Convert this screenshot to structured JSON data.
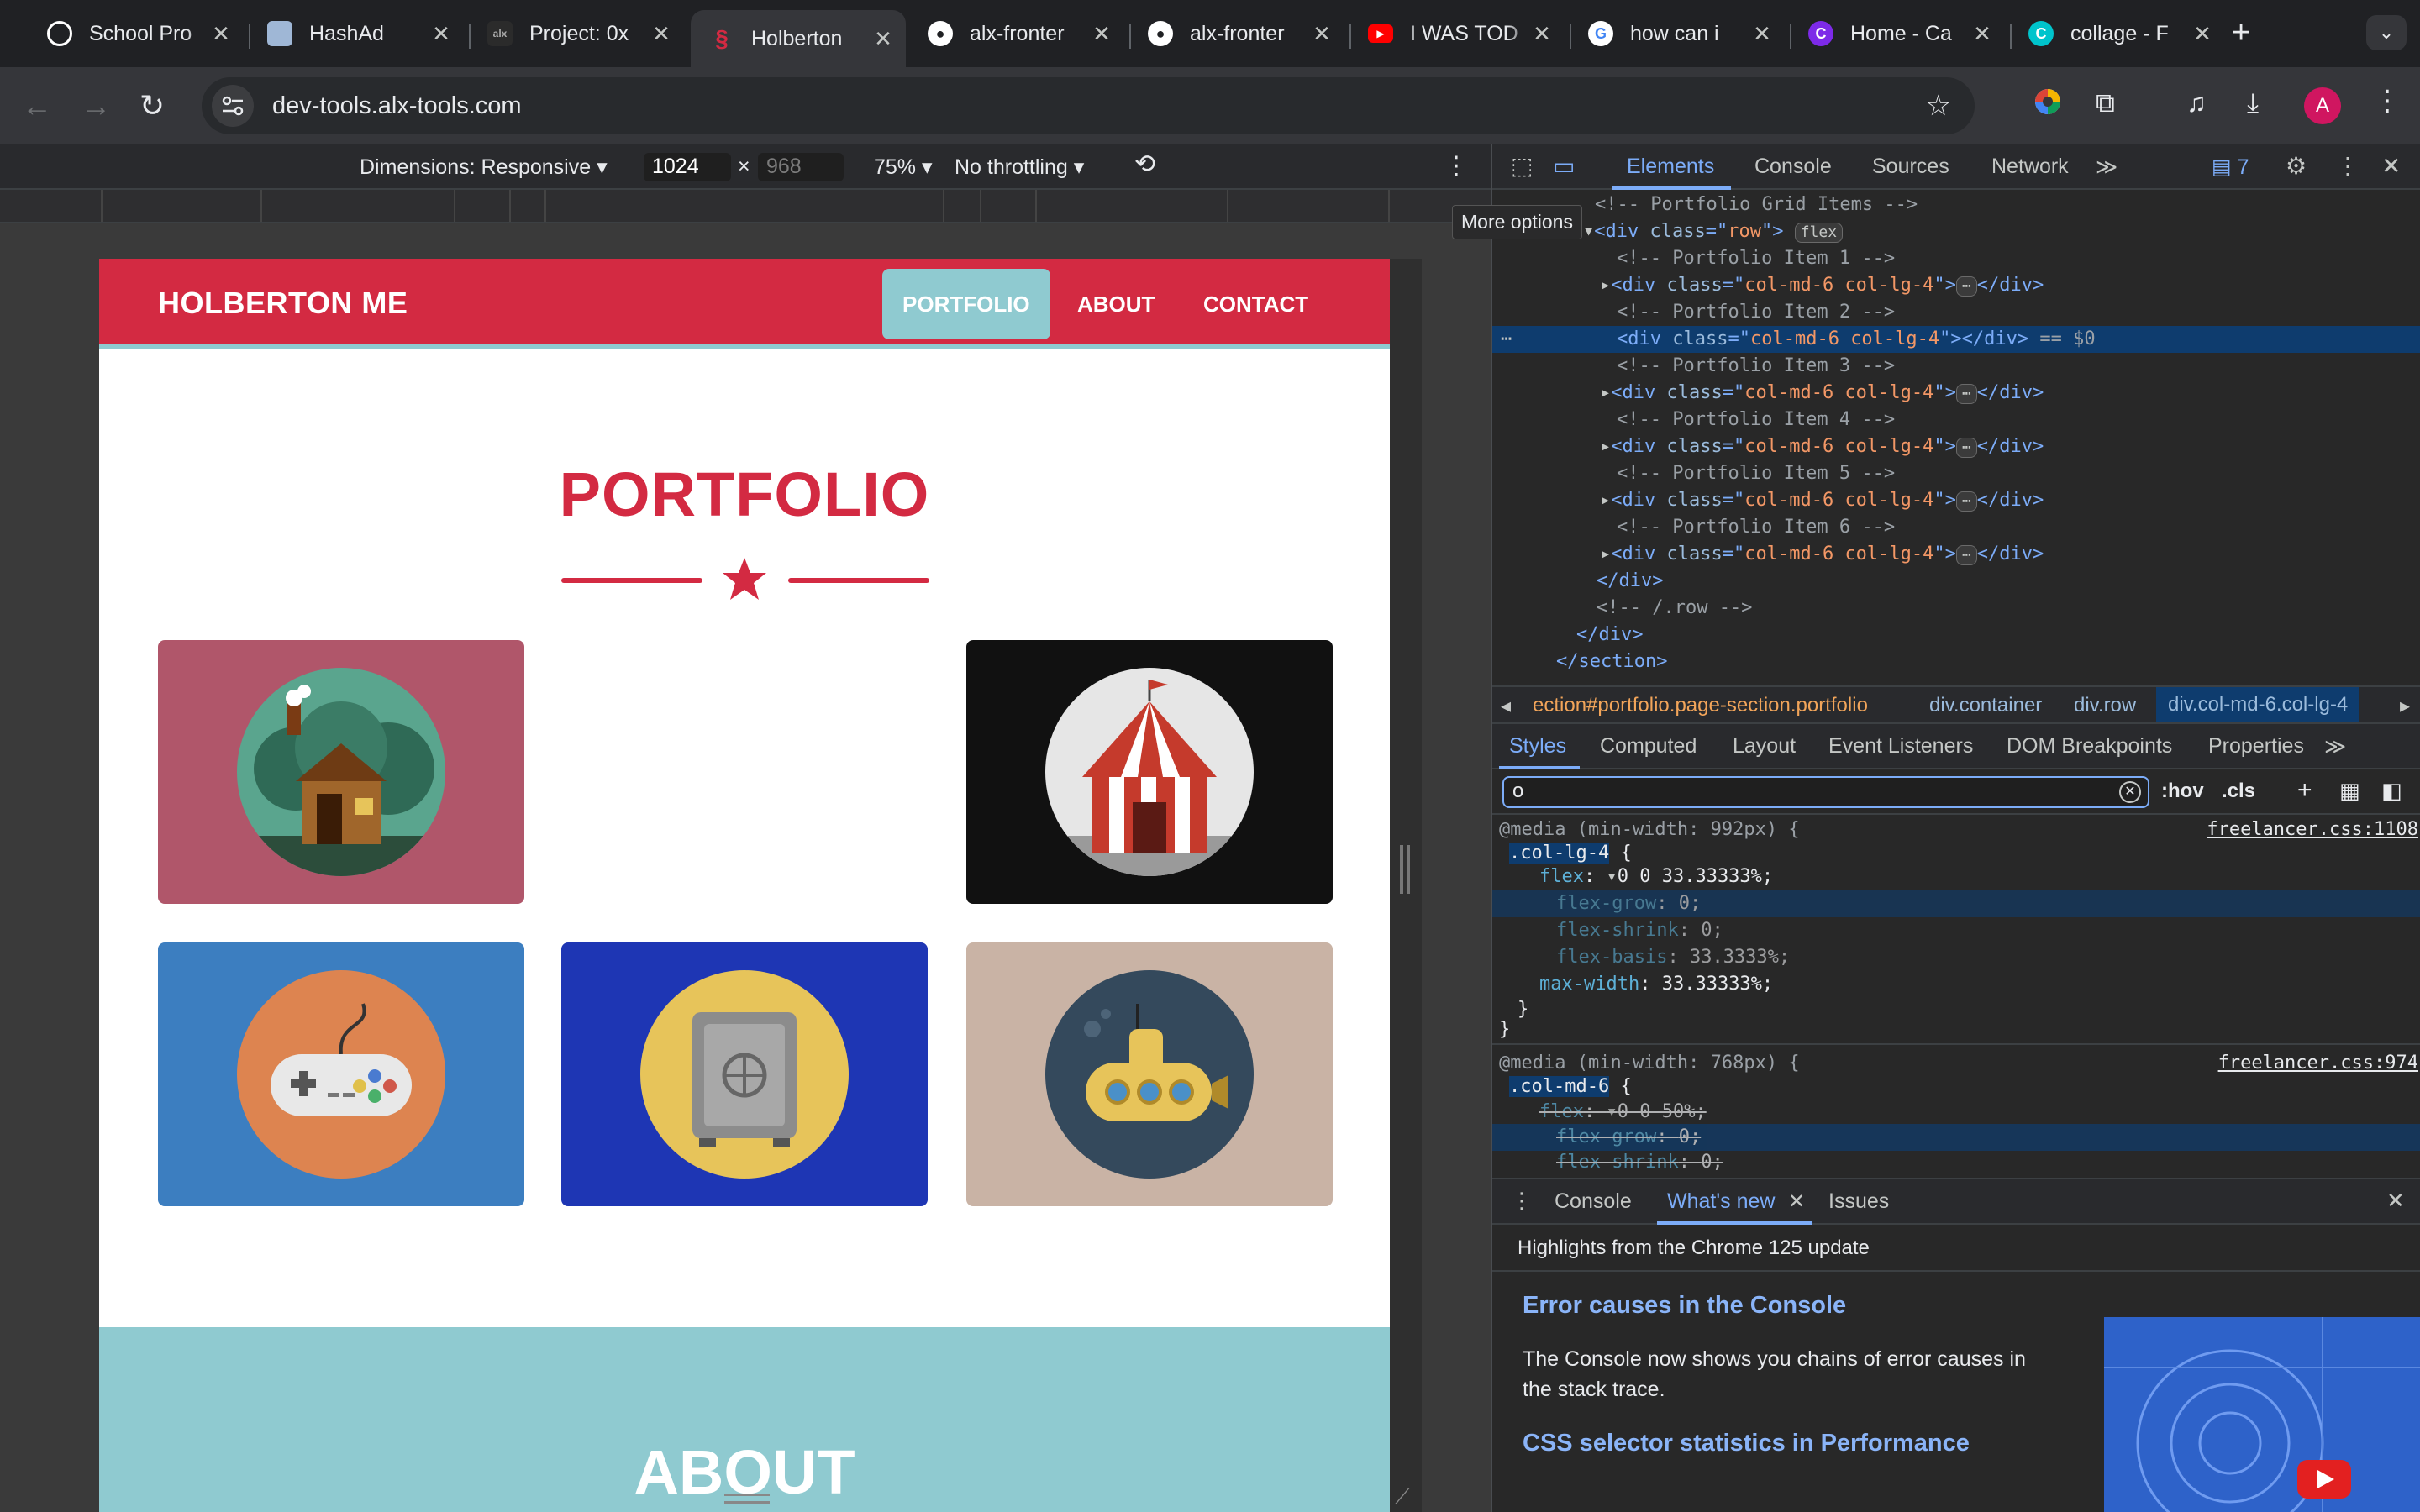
{
  "browser": {
    "tabs": [
      {
        "title": "School Pro",
        "icon": "openai-icon",
        "color": "#ffffff"
      },
      {
        "title": "HashAd",
        "icon": "hashad-icon",
        "color": "#9fb7d6"
      },
      {
        "title": "Project: 0x",
        "icon": "alx-icon",
        "color": "#202124"
      },
      {
        "title": "Holberton",
        "icon": "holberton-icon",
        "color": "#d32a42"
      },
      {
        "title": "alx-fronter",
        "icon": "github-icon",
        "color": "#ffffff"
      },
      {
        "title": "alx-fronter",
        "icon": "github-icon",
        "color": "#ffffff"
      },
      {
        "title": "I WAS TOD",
        "icon": "youtube-icon",
        "color": "#ff0000"
      },
      {
        "title": "how can i",
        "icon": "google-icon",
        "color": "#ffffff"
      },
      {
        "title": "Home - Ca",
        "icon": "canva-icon",
        "color": "#7d2ae8"
      },
      {
        "title": "collage - F",
        "icon": "canva-icon",
        "color": "#00c4cc"
      }
    ],
    "url": "dev-tools.alx-tools.com",
    "profile_initial": "A"
  },
  "device_toolbar": {
    "dimensions_label": "Dimensions: Responsive",
    "width": "1024",
    "times": "×",
    "height": "968",
    "zoom": "75%",
    "throttling": "No throttling"
  },
  "tooltip": "More options",
  "site": {
    "brand": "HOLBERTON ME",
    "nav": [
      "PORTFOLIO",
      "ABOUT",
      "CONTACT"
    ],
    "title": "PORTFOLIO",
    "about_title": "ABOUT",
    "colors": {
      "primary": "#d32a42",
      "accent": "#8fcad0"
    },
    "cards": [
      {
        "name": "cabin",
        "bg": "#b0566a",
        "circle": "#5aa58e"
      },
      {
        "name": "circus",
        "bg": "#111111",
        "circle": "#e6e6e6"
      },
      {
        "name": "game",
        "bg": "#3c7ec0",
        "circle": "#dd8450"
      },
      {
        "name": "safe",
        "bg": "#1e36b4",
        "circle": "#e7c45a"
      },
      {
        "name": "submarine",
        "bg": "#c9b3a5",
        "circle": "#34495c"
      }
    ]
  },
  "devtools": {
    "tabs": [
      "Elements",
      "Console",
      "Sources",
      "Network"
    ],
    "issues_count": "7",
    "dom": {
      "comment_grid": "<!-- Portfolio Grid Items -->",
      "row_open_tag": "div",
      "row_class": "row",
      "flex_badge": "flex",
      "item_tag": "div",
      "item_class": "col-md-6 col-lg-4",
      "item_comments": [
        "<!-- Portfolio Item 1 -->",
        "<!-- Portfolio Item 2 -->",
        "<!-- Portfolio Item 3 -->",
        "<!-- Portfolio Item 4 -->",
        "<!-- Portfolio Item 5 -->",
        "<!-- Portfolio Item 6 -->"
      ],
      "selected_suffix": "== $0",
      "close_div": "</div>",
      "row_end_comment": "<!-- /.row -->",
      "close_section": "</section>"
    },
    "breadcrumbs": [
      "ection#portfolio.page-section.portfolio",
      "div.container",
      "div.row",
      "div.col-md-6.col-lg-4"
    ],
    "style_tabs": [
      "Styles",
      "Computed",
      "Layout",
      "Event Listeners",
      "DOM Breakpoints",
      "Properties"
    ],
    "filter_value": "o",
    "hov": ":hov",
    "cls": ".cls",
    "rules": [
      {
        "media": "@media (min-width: 992px) {",
        "source": "freelancer.css:1108",
        "selector": ".col-lg-4",
        "decls": [
          {
            "prop": "flex",
            "value": "0 0 33.33333%;"
          },
          {
            "prop": "flex-grow",
            "value": "0;"
          },
          {
            "prop": "flex-shrink",
            "value": "0;"
          },
          {
            "prop": "flex-basis",
            "value": "33.3333%;"
          },
          {
            "prop": "max-width",
            "value": "33.33333%;"
          }
        ]
      },
      {
        "media": "@media (min-width: 768px) {",
        "source": "freelancer.css:974",
        "selector": ".col-md-6",
        "decls": [
          {
            "prop": "flex",
            "value": "0 0 50%;"
          },
          {
            "prop": "flex-grow",
            "value": "0;"
          },
          {
            "prop": "flex-shrink",
            "value": "0;"
          }
        ]
      }
    ],
    "drawer_tabs": [
      "Console",
      "What's new",
      "Issues"
    ],
    "whats_new": {
      "header": "Highlights from the Chrome 125 update",
      "h1": "Error causes in the Console",
      "p1": "The Console now shows you chains of error causes in the stack trace.",
      "h2": "CSS selector statistics in Performance"
    }
  }
}
